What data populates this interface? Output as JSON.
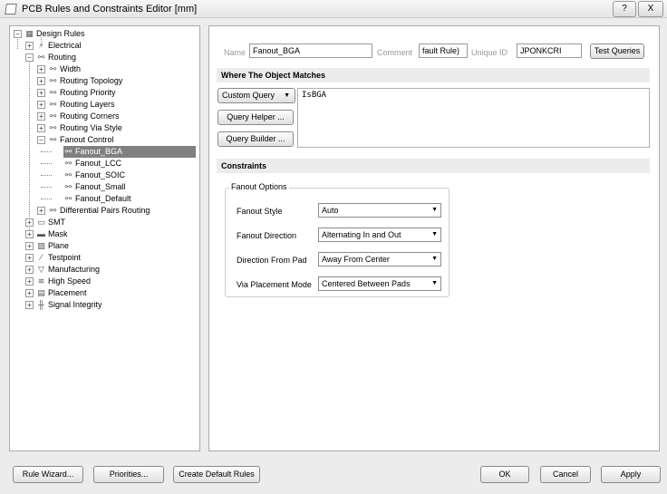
{
  "window": {
    "title": "PCB Rules and Constraints Editor [mm]",
    "help_label": "?",
    "close_label": "X"
  },
  "tree": {
    "items": [
      {
        "label": "Design Rules",
        "icon": "design-rules-icon",
        "glyph": "▦",
        "exp": "−"
      },
      {
        "label": "Electrical",
        "icon": "electrical-icon",
        "glyph": "⚡",
        "exp": "+"
      },
      {
        "label": "Routing",
        "icon": "routing-icon",
        "glyph": "⚯",
        "exp": "−"
      },
      {
        "label": "Width",
        "icon": "rule-icon",
        "glyph": "⚯",
        "exp": "+"
      },
      {
        "label": "Routing Topology",
        "icon": "rule-icon",
        "glyph": "⚯",
        "exp": "+"
      },
      {
        "label": "Routing Priority",
        "icon": "rule-icon",
        "glyph": "⚯",
        "exp": "+"
      },
      {
        "label": "Routing Layers",
        "icon": "rule-icon",
        "glyph": "⚯",
        "exp": "+"
      },
      {
        "label": "Routing Corners",
        "icon": "rule-icon",
        "glyph": "⚯",
        "exp": "+"
      },
      {
        "label": "Routing Via Style",
        "icon": "rule-icon",
        "glyph": "⚯",
        "exp": "+"
      },
      {
        "label": "Fanout Control",
        "icon": "rule-icon",
        "glyph": "⚯",
        "exp": "−"
      },
      {
        "label": "Fanout_BGA",
        "icon": "rule-icon",
        "glyph": "⚯",
        "exp": ""
      },
      {
        "label": "Fanout_LCC",
        "icon": "rule-icon",
        "glyph": "⚯",
        "exp": ""
      },
      {
        "label": "Fanout_SOIC",
        "icon": "rule-icon",
        "glyph": "⚯",
        "exp": ""
      },
      {
        "label": "Fanout_Small",
        "icon": "rule-icon",
        "glyph": "⚯",
        "exp": ""
      },
      {
        "label": "Fanout_Default",
        "icon": "rule-icon",
        "glyph": "⚯",
        "exp": ""
      },
      {
        "label": "Differential Pairs Routing",
        "icon": "rule-icon",
        "glyph": "⚯",
        "exp": "+"
      },
      {
        "label": "SMT",
        "icon": "smt-icon",
        "glyph": "▭",
        "exp": "+"
      },
      {
        "label": "Mask",
        "icon": "mask-icon",
        "glyph": "▬",
        "exp": "+"
      },
      {
        "label": "Plane",
        "icon": "plane-icon",
        "glyph": "▨",
        "exp": "+"
      },
      {
        "label": "Testpoint",
        "icon": "testpoint-icon",
        "glyph": "⁄",
        "exp": "+"
      },
      {
        "label": "Manufacturing",
        "icon": "manufacturing-icon",
        "glyph": "▽",
        "exp": "+"
      },
      {
        "label": "High Speed",
        "icon": "high-speed-icon",
        "glyph": "≋",
        "exp": "+"
      },
      {
        "label": "Placement",
        "icon": "placement-icon",
        "glyph": "▤",
        "exp": "+"
      },
      {
        "label": "Signal Integrity",
        "icon": "signal-integrity-icon",
        "glyph": "╫",
        "exp": "+"
      }
    ]
  },
  "rule": {
    "name_label": "Name",
    "name_value": "Fanout_BGA",
    "comment_label": "Comment",
    "comment_value": "fault Rule)",
    "uid_label": "Unique ID",
    "uid_value": "JPONKCRI",
    "test_queries_label": "Test Queries"
  },
  "where": {
    "section_title": "Where The Object Matches",
    "custom_query_label": "Custom Query",
    "query_helper_label": "Query Helper ...",
    "query_builder_label": "Query Builder ...",
    "query_text": "IsBGA"
  },
  "constraints": {
    "section_title": "Constraints",
    "group_title": "Fanout Options",
    "fanout_style_label": "Fanout Style",
    "fanout_style_value": "Auto",
    "fanout_direction_label": "Fanout Direction",
    "fanout_direction_value": "Alternating In and Out",
    "direction_from_pad_label": "Direction From Pad",
    "direction_from_pad_value": "Away From Center",
    "via_placement_label": "Via Placement Mode",
    "via_placement_value": "Centered Between Pads"
  },
  "footer": {
    "rule_wizard_label": "Rule Wizard...",
    "priorities_label": "Priorities...",
    "create_default_label": "Create Default Rules",
    "ok_label": "OK",
    "cancel_label": "Cancel",
    "apply_label": "Apply"
  }
}
